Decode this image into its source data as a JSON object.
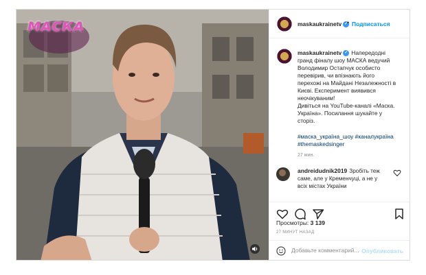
{
  "post": {
    "show_logo": "МАСКА",
    "username": "maskaukrainetv",
    "follow_label": "Подписаться",
    "caption": {
      "lines": [
        "Напередодні",
        "гранд фіналу шоу МАСКА ведучий",
        "Володимир Остапчук особисто",
        "перевірив, чи впізнають його",
        "перехожі на Майдані Незалежності в",
        "Києві. Експеримент виявився",
        "неочікуваним!",
        "Дивіться на YouTube-каналі «Маска.",
        "Україна». Посилання шукайте у",
        "сторіз."
      ],
      "hashtags": [
        "#маска_україна_шоу #каналукраїна",
        "#themaskedsinger"
      ],
      "time": "27 мин."
    },
    "comment": {
      "username": "andreidudnik2019",
      "text": "Зробіть теж саме, але у Кременчуці, а не у всіх містах України"
    },
    "views_label": "Просмотры:",
    "views_count": "3 139",
    "posted_ago": "27 МИНУТ НАЗАД",
    "add_comment_placeholder": "Добавьте комментарий...",
    "publish_label": "Опубликовать"
  },
  "colors": {
    "link_blue": "#0095f6",
    "hashtag": "#00376b",
    "publish_disabled": "#b2dffc",
    "text": "#262626",
    "muted": "#8e8e8e"
  },
  "icons": [
    "verified-badge-icon",
    "heart-icon",
    "comment-icon",
    "share-icon",
    "bookmark-icon",
    "smile-icon",
    "sound-icon"
  ]
}
